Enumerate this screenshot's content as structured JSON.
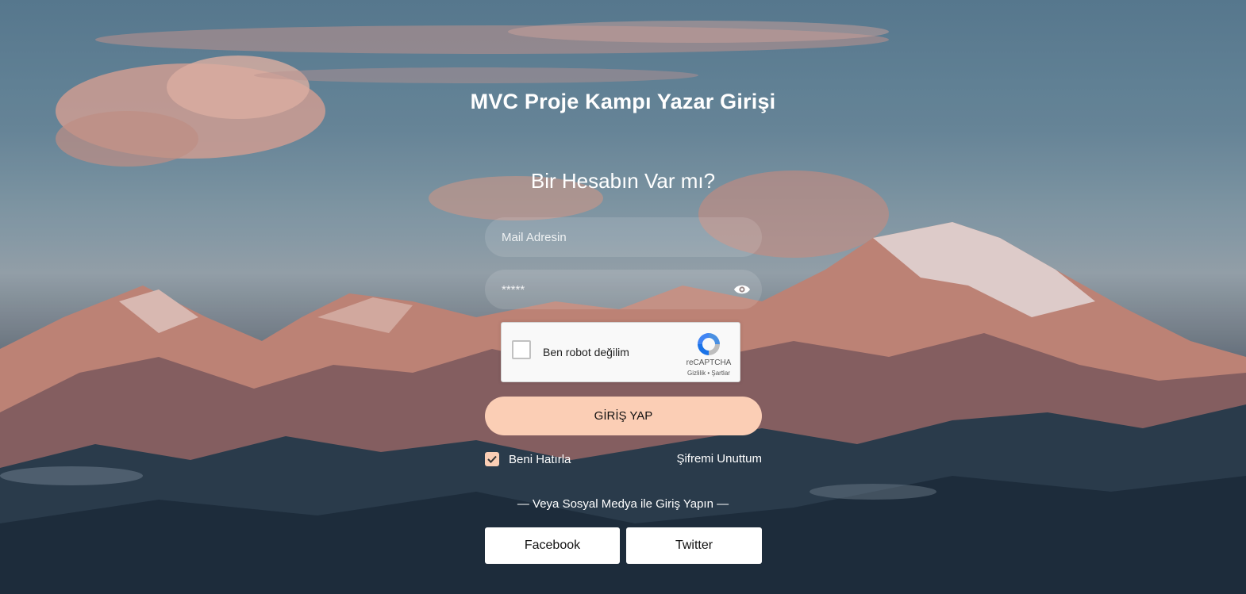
{
  "page": {
    "title": "MVC Proje Kampı Yazar Girişi",
    "subtitle": "Bir Hesabın Var mı?"
  },
  "form": {
    "email_placeholder": "Mail Adresin",
    "email_value": "",
    "password_placeholder": "*****",
    "password_value": "",
    "login_label": "GİRİŞ YAP",
    "remember_label": "Beni Hatırla",
    "remember_checked": true,
    "forgot_label": "Şifremi Unuttum"
  },
  "captcha": {
    "label": "Ben robot değilim",
    "brand": "reCAPTCHA",
    "terms": "Gizlilik • Şartlar"
  },
  "social": {
    "label": "— Veya Sosyal Medya ile Giriş Yapın —",
    "facebook_label": "Facebook",
    "twitter_label": "Twitter"
  },
  "icons": {
    "eye": "eye-icon",
    "recaptcha": "recaptcha-logo-icon",
    "check": "check-icon"
  },
  "colors": {
    "accent": "#fbceb5",
    "text": "#ffffff"
  }
}
